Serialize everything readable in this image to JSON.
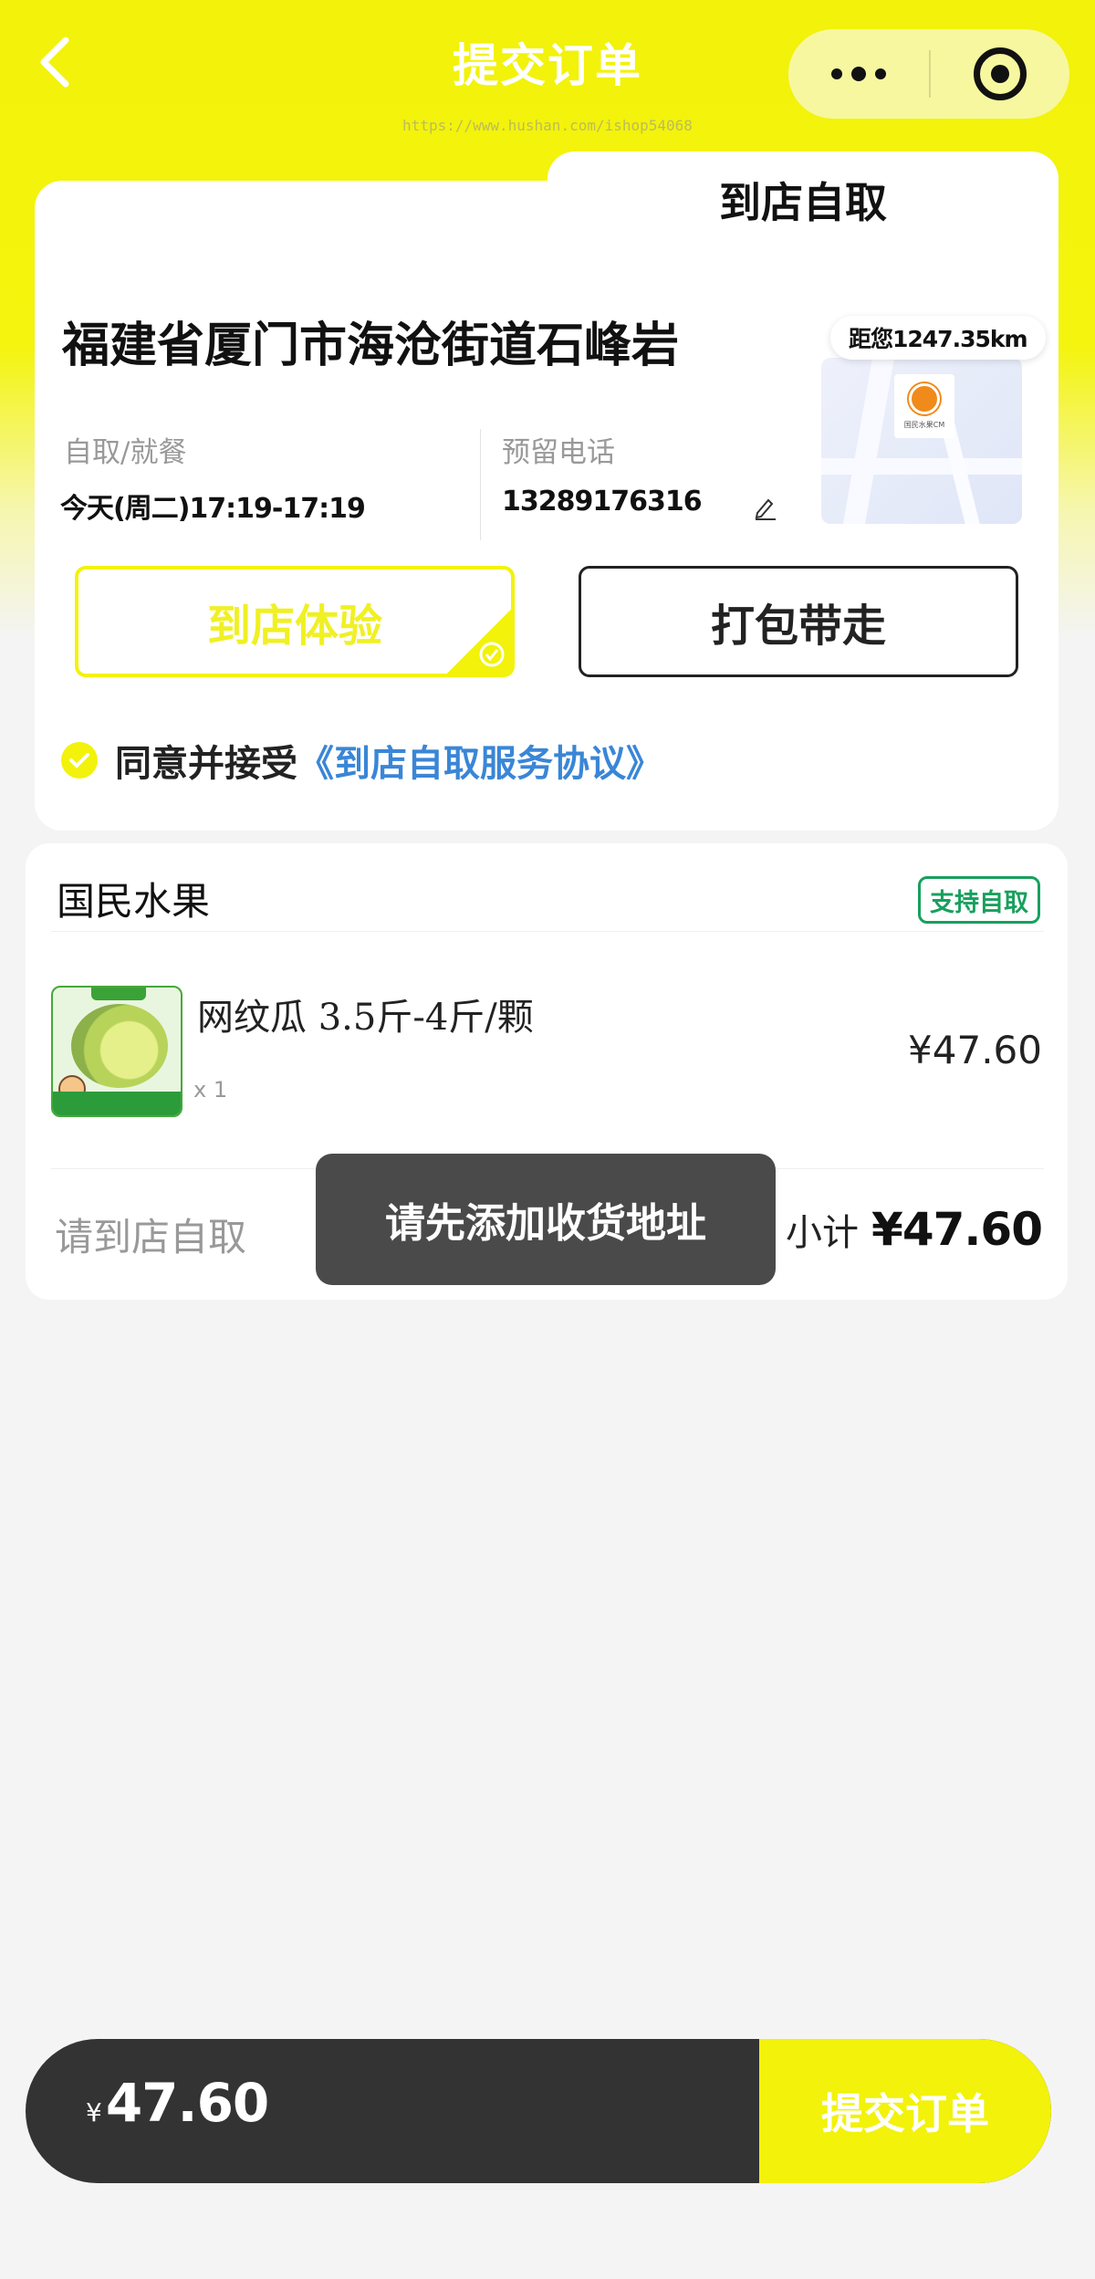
{
  "colors": {
    "brand_yellow": "#f2f20a",
    "badge_green": "#18a05e",
    "link_blue": "#3a86d6",
    "bar_dark": "#333333"
  },
  "nav": {
    "title": "提交订单",
    "watermark": "https://www.hushan.com/ishop54068",
    "back_icon": "chevron-left-icon",
    "more_icon": "more-dots-icon",
    "close_icon": "target-icon"
  },
  "pickup": {
    "tab_label": "到店自取",
    "address": "福建省厦门市海沧街道石峰岩",
    "distance": "距您1247.35km",
    "map_shop_label": "国民水果CM",
    "time_label": "自取/就餐",
    "time_value": "今天(周二)17:19-17:19",
    "phone_label": "预留电话",
    "phone_value": "13289176316",
    "edit_icon": "pencil-icon",
    "options": [
      {
        "label": "到店体验",
        "selected": true
      },
      {
        "label": "打包带走",
        "selected": false
      }
    ],
    "agree_prefix": "同意并接受",
    "agree_link": "《到店自取服务协议》"
  },
  "goods": {
    "shop_name": "国民水果",
    "self_pickup_badge": "支持自取",
    "items": [
      {
        "name": "网纹瓜 3.5斤-4斤/颗",
        "qty": "x 1",
        "price": "¥47.60"
      }
    ],
    "pickup_hint": "请到店自取",
    "subtotal_label": "小计",
    "subtotal_value": "¥47.60"
  },
  "toast": "请先添加收货地址",
  "footer": {
    "currency": "¥",
    "total": "47.60",
    "submit_label": "提交订单"
  }
}
